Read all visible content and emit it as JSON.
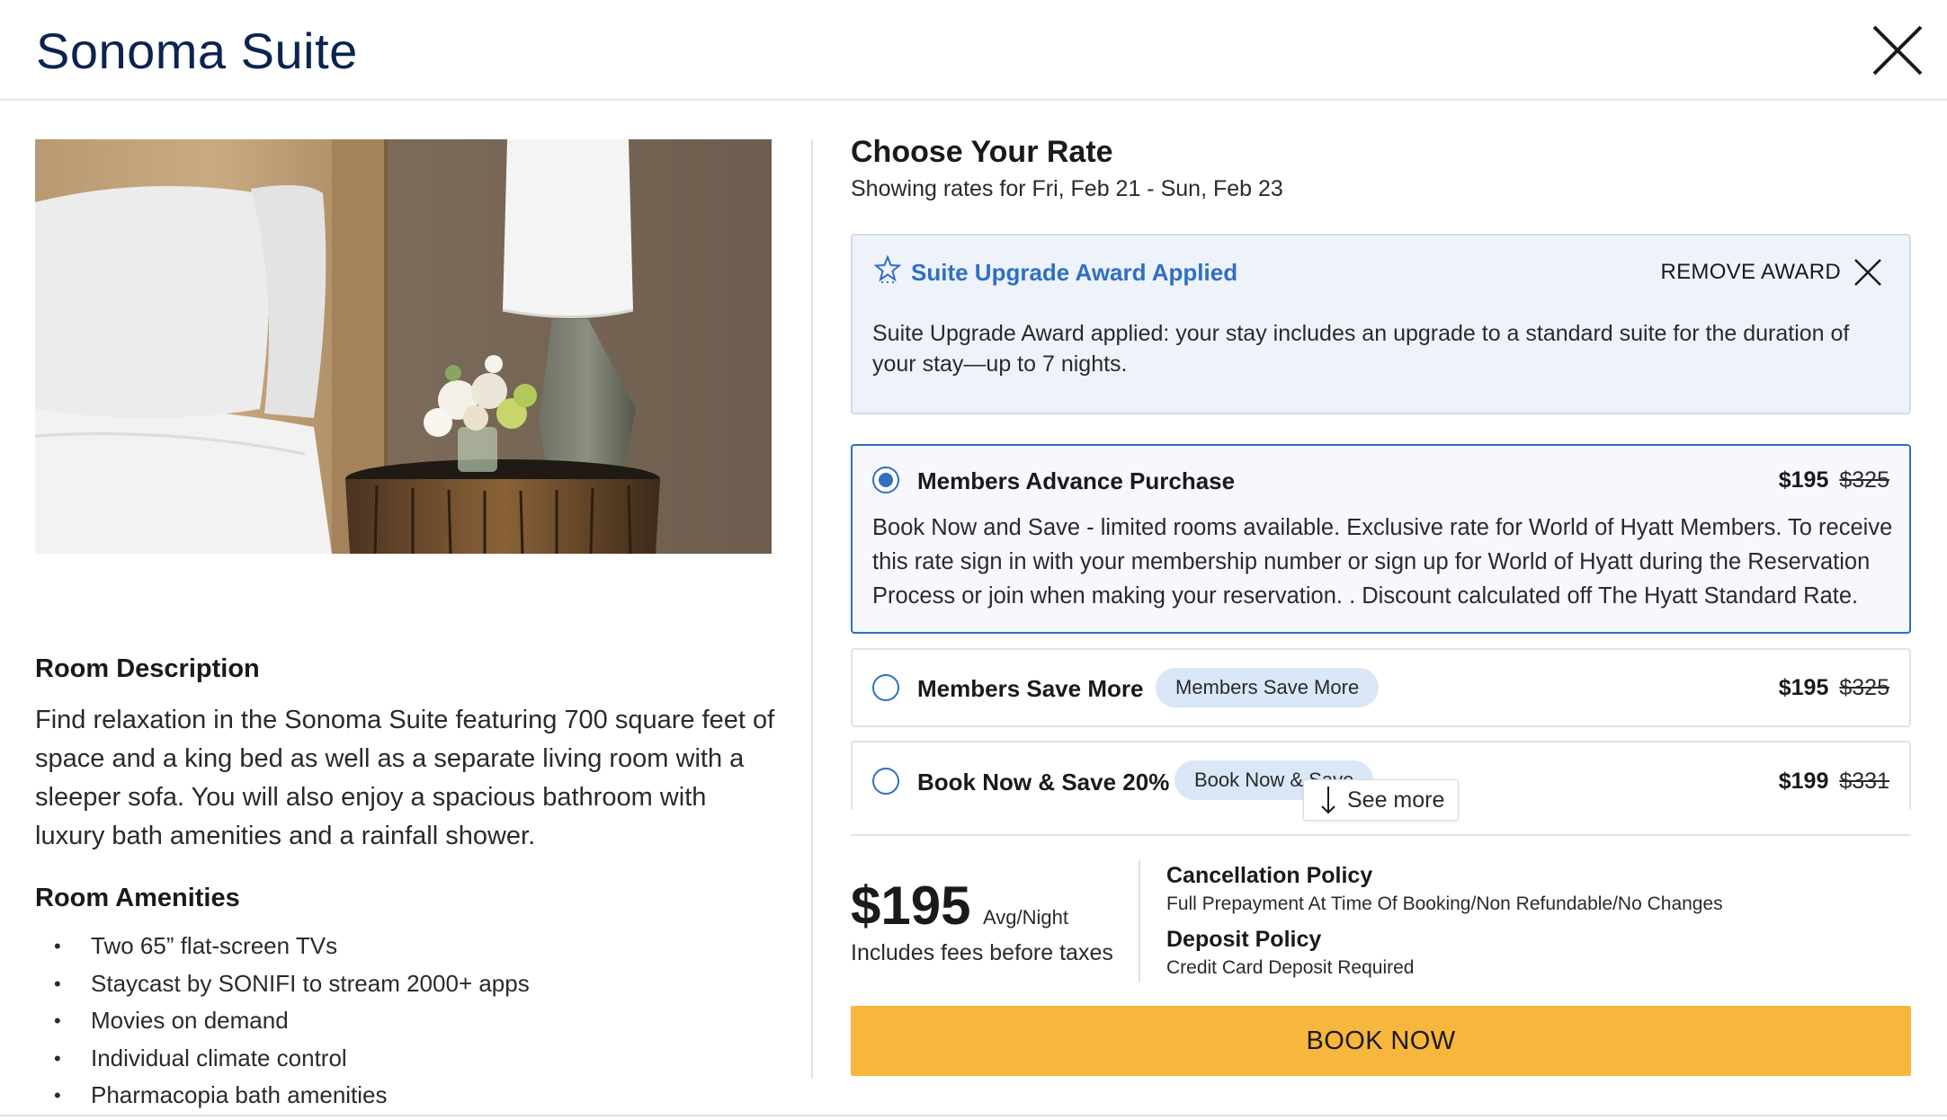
{
  "header": {
    "title": "Sonoma Suite"
  },
  "room": {
    "description_heading": "Room Description",
    "description": "Find relaxation in the Sonoma Suite featuring 700 square feet of space and a king bed as well as a separate living room with a sleeper sofa. You will also enjoy a spacious bathroom with luxury bath amenities and a rainfall shower.",
    "amenities_heading": "Room Amenities",
    "amenities": [
      "Two 65” flat-screen TVs",
      "Staycast by SONIFI to stream 2000+ apps",
      "Movies on demand",
      "Individual climate control",
      "Pharmacopia bath amenities"
    ]
  },
  "rates": {
    "heading": "Choose Your Rate",
    "subheading": "Showing rates for Fri, Feb 21 - Sun, Feb 23",
    "award": {
      "title": "Suite Upgrade Award Applied",
      "remove_label": "REMOVE AWARD",
      "text": "Suite Upgrade Award applied: your stay includes an upgrade to a standard suite for the duration of your stay—up to 7 nights."
    },
    "options": [
      {
        "name": "Members Advance Purchase",
        "price": "$195",
        "original_price": "$325",
        "selected": true,
        "description": "Book Now and Save - limited rooms available. Exclusive rate for World of Hyatt Members. To receive this rate sign in with your membership number or sign up for World of Hyatt during the Reservation Process or join when making your reservation. . Discount calculated off The Hyatt Standard Rate."
      },
      {
        "name": "Members Save More",
        "tag": "Members Save More",
        "price": "$195",
        "original_price": "$325",
        "selected": false
      },
      {
        "name": "Book Now & Save 20%",
        "tag": "Book Now & Save",
        "price": "$199",
        "original_price": "$331",
        "selected": false
      }
    ],
    "see_more_label": "See more"
  },
  "summary": {
    "price": "$195",
    "price_unit": "Avg/Night",
    "fees_note": "Includes fees before taxes",
    "cancellation_heading": "Cancellation Policy",
    "cancellation_text": "Full Prepayment At Time Of Booking/Non Refundable/No Changes",
    "deposit_heading": "Deposit Policy",
    "deposit_text": "Credit Card Deposit Required",
    "book_label": "BOOK NOW"
  },
  "colors": {
    "title_navy": "#0c2350",
    "accent_blue": "#2f6fc4",
    "award_bg": "#eef3fb",
    "tag_bg": "#d9e7f7",
    "book_button": "#f6b73c"
  },
  "icons": [
    "close-icon",
    "star-award-icon",
    "remove-x-icon",
    "arrow-down-icon"
  ]
}
